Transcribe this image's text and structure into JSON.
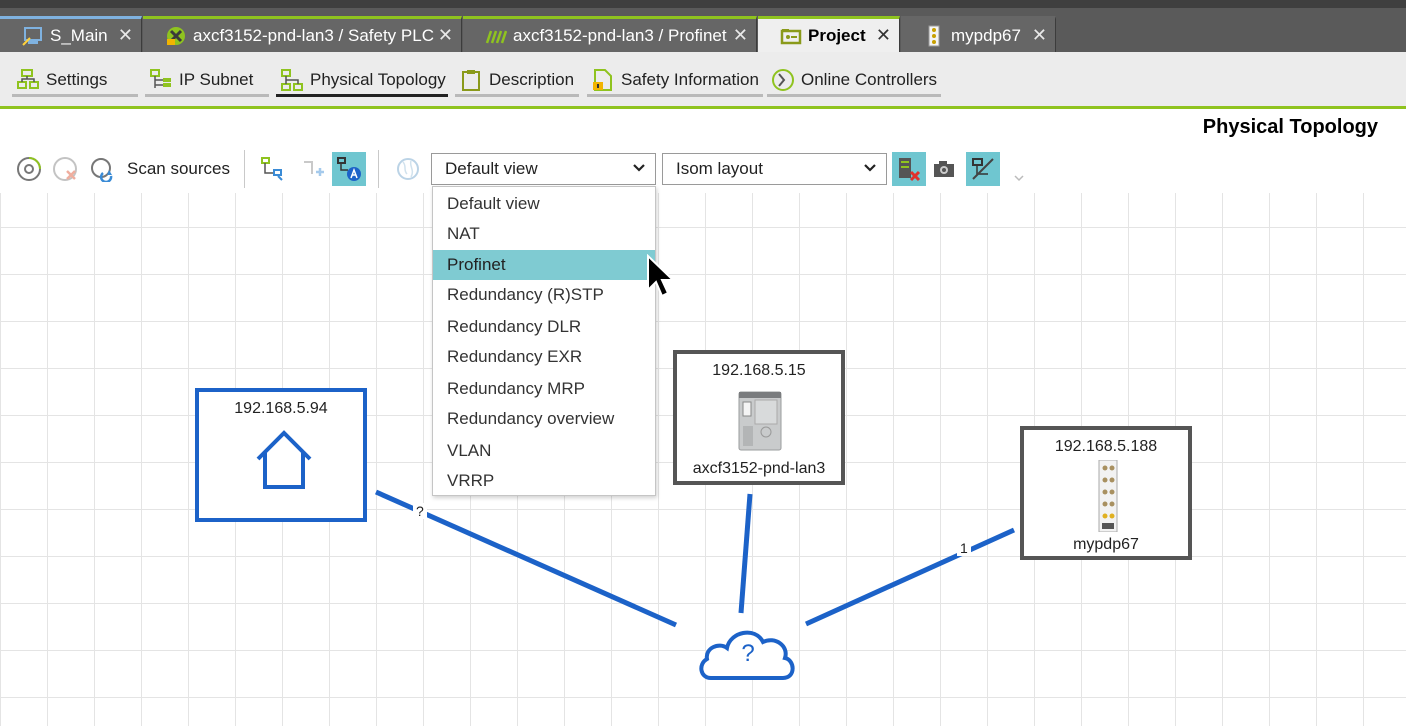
{
  "tabs": [
    {
      "label": "S_Main",
      "close": "✕",
      "icon": "project-monitor-icon"
    },
    {
      "label": "axcf3152-pnd-lan3 / Safety PLC",
      "close": "✕",
      "icon": "safety-plc-icon"
    },
    {
      "label": "axcf3152-pnd-lan3 / Profinet",
      "close": "✕",
      "icon": "profinet-icon"
    },
    {
      "label": "Project",
      "close": "✕",
      "icon": "project-icon"
    },
    {
      "label": "mypdp67",
      "close": "✕",
      "icon": "io-module-icon"
    }
  ],
  "editor_tabs": [
    {
      "label": "Settings",
      "icon": "settings-tree-icon"
    },
    {
      "label": "IP Subnet",
      "icon": "ip-subnet-icon"
    },
    {
      "label": "Physical Topology",
      "icon": "physical-topology-icon"
    },
    {
      "label": "Description",
      "icon": "clipboard-icon"
    },
    {
      "label": "Safety Information",
      "icon": "safety-info-icon"
    },
    {
      "label": "Online Controllers",
      "icon": "online-controllers-icon"
    }
  ],
  "page_title": "Physical Topology",
  "toolbar": {
    "scan_label": "Scan sources",
    "view_select": "Default view",
    "layout_select": "Isom layout"
  },
  "dropdown": {
    "items": [
      "Default view",
      "NAT",
      "Profinet",
      "Redundancy (R)STP",
      "Redundancy DLR",
      "Redundancy EXR",
      "Redundancy MRP",
      "Redundancy overview",
      "VLAN",
      "VRRP"
    ],
    "highlighted": "Profinet"
  },
  "nodes": {
    "router": {
      "ip": "192.168.5.94"
    },
    "plc": {
      "ip": "192.168.5.15",
      "name": "axcf3152-pnd-lan3"
    },
    "dp": {
      "ip": "192.168.5.188",
      "name": "mypdp67"
    }
  },
  "cloud": {
    "label": "?"
  },
  "links": {
    "router_port": "?",
    "dp_port": "1"
  },
  "colors": {
    "accent_green": "#8fc31f",
    "link_blue": "#1c62c8",
    "highlight": "#7fcbd2"
  }
}
